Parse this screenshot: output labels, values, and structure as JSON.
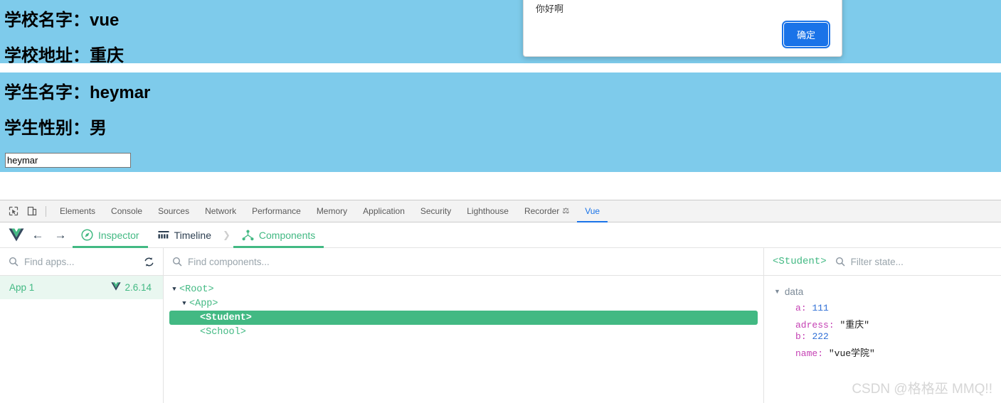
{
  "page": {
    "school_name_label": "学校名字：",
    "school_name_value": "vue",
    "school_addr_label": "学校地址：",
    "school_addr_value": "重庆",
    "student_name_label": "学生名字：",
    "student_name_value": "heymar",
    "student_sex_label": "学生性别：",
    "student_sex_value": "男",
    "input_value": "heymar",
    "input_placeholder": "",
    "bg_color": "#7ecbeb"
  },
  "dialog": {
    "message": "你好啊",
    "ok_label": "确定",
    "button_color": "#1a73e8"
  },
  "devtools": {
    "tabs": [
      {
        "label": "Elements",
        "active": false
      },
      {
        "label": "Console",
        "active": false
      },
      {
        "label": "Sources",
        "active": false
      },
      {
        "label": "Network",
        "active": false
      },
      {
        "label": "Performance",
        "active": false
      },
      {
        "label": "Memory",
        "active": false
      },
      {
        "label": "Application",
        "active": false
      },
      {
        "label": "Security",
        "active": false
      },
      {
        "label": "Lighthouse",
        "active": false
      },
      {
        "label": "Recorder",
        "active": false
      },
      {
        "label": "Vue",
        "active": true
      }
    ],
    "active_tab": "Vue",
    "accent_color": "#1a73e8"
  },
  "vue_devtools": {
    "accent_color": "#42b983",
    "nav": {
      "back_glyph": "←",
      "forward_glyph": "→"
    },
    "tabs": [
      {
        "label": "Inspector",
        "active": true,
        "icon": "compass-icon"
      },
      {
        "label": "Timeline",
        "active": false,
        "icon": "timeline-icon"
      },
      {
        "label": "Components",
        "active": true,
        "icon": "components-icon"
      }
    ],
    "apps_panel": {
      "search_placeholder": "Find apps...",
      "apps": [
        {
          "name": "App 1",
          "version": "2.6.14",
          "selected": true
        }
      ]
    },
    "tree_panel": {
      "search_placeholder": "Find components...",
      "nodes": [
        {
          "label": "<Root>",
          "depth": 1,
          "expandable": true,
          "selected": false
        },
        {
          "label": "<App>",
          "depth": 2,
          "expandable": true,
          "selected": false
        },
        {
          "label": "<Student>",
          "depth": 3,
          "expandable": false,
          "selected": true
        },
        {
          "label": "<School>",
          "depth": 3,
          "expandable": false,
          "selected": false
        }
      ]
    },
    "state_panel": {
      "component": "<Student>",
      "filter_placeholder": "Filter state...",
      "group_label": "data",
      "entries": [
        {
          "key": "a",
          "value": "111",
          "type": "number"
        },
        {
          "key": "adress",
          "value": "\"重庆\"",
          "type": "string"
        },
        {
          "key": "b",
          "value": "222",
          "type": "number"
        },
        {
          "key": "name",
          "value": "\"vue学院\"",
          "type": "string"
        }
      ]
    }
  },
  "watermark": {
    "text": "CSDN @格格巫 MMQ!!"
  }
}
